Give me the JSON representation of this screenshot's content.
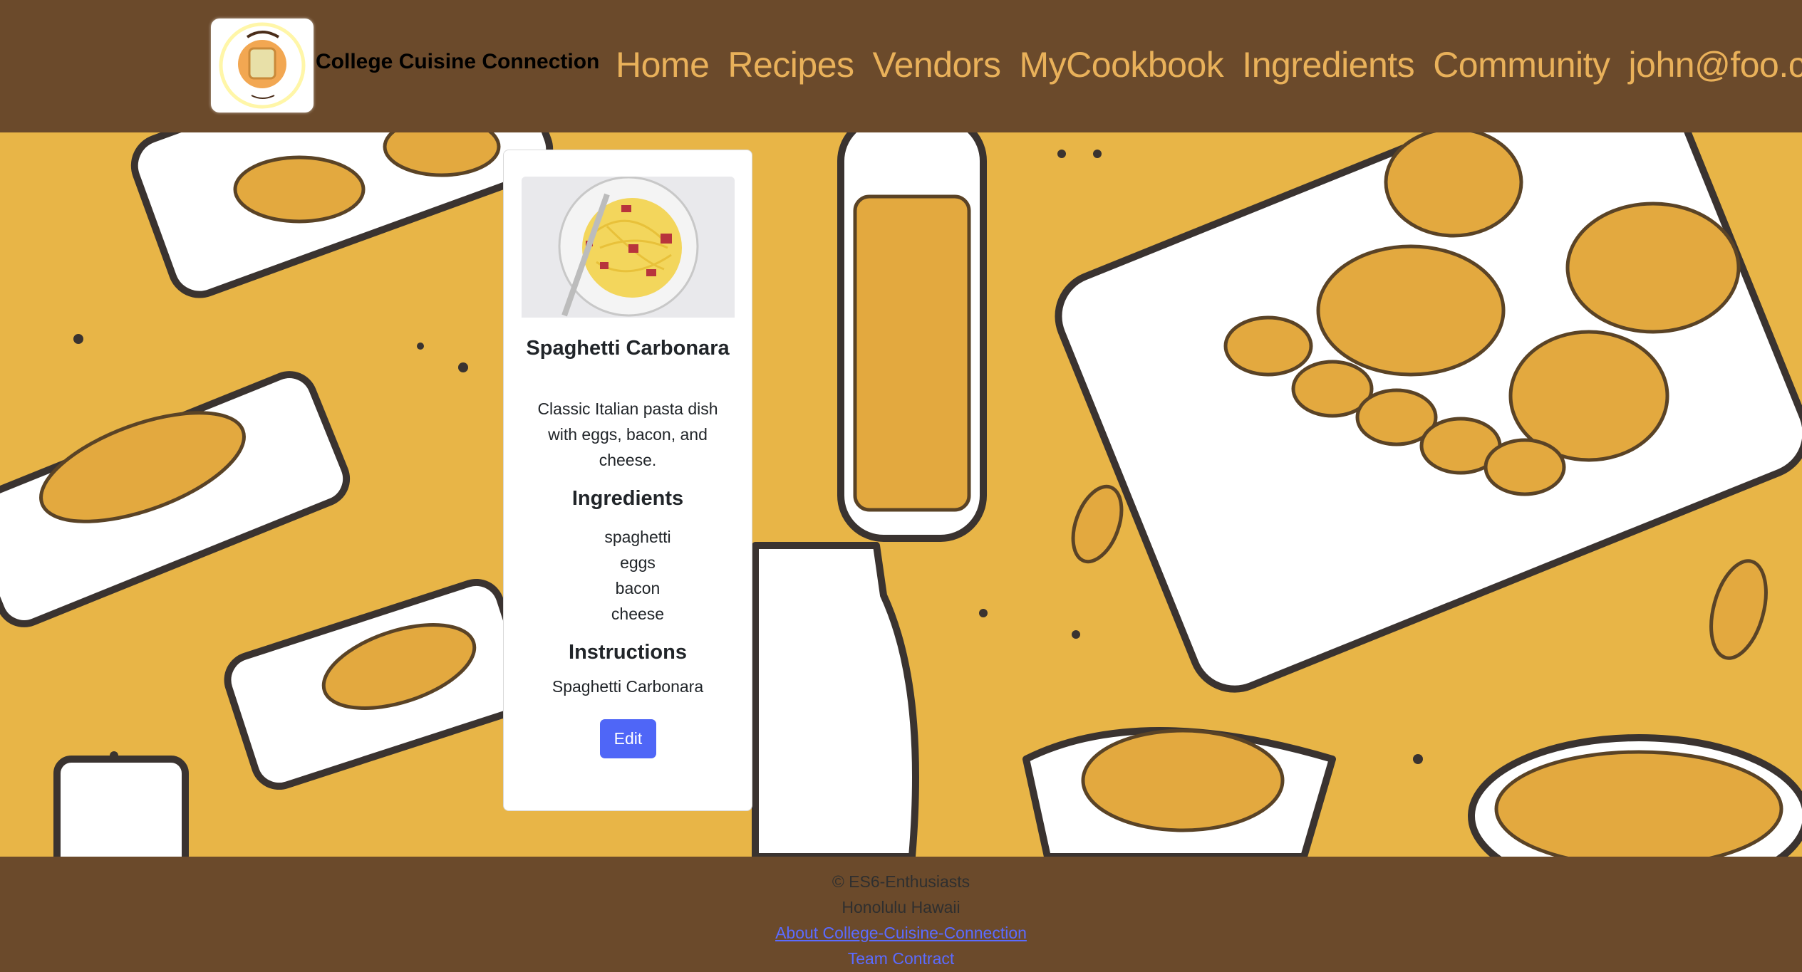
{
  "navbar": {
    "logo_alt": "College Cuisine Connection logo",
    "logo_text_top": "College Cuisine",
    "logo_text_bottom": "Connection",
    "brand": "College Cuisine Connection",
    "links": [
      {
        "label": "Home"
      },
      {
        "label": "Recipes"
      },
      {
        "label": "Vendors"
      },
      {
        "label": "MyCookbook"
      },
      {
        "label": "Ingredients"
      },
      {
        "label": "Community"
      },
      {
        "label": "john@foo.com"
      }
    ],
    "colors": {
      "background": "#6B4A2B",
      "link": "#E9B15A"
    }
  },
  "recipe_card": {
    "image_alt": "Spaghetti Carbonara",
    "title": "Spaghetti Carbonara",
    "description": "Classic Italian pasta dish with eggs, bacon, and cheese.",
    "ingredients_heading": "Ingredients",
    "ingredients": [
      "spaghetti",
      "eggs",
      "bacon",
      "cheese"
    ],
    "instructions_heading": "Instructions",
    "instructions": "Spaghetti Carbonara",
    "edit_label": "Edit",
    "colors": {
      "button": "#4F66F7"
    }
  },
  "footer": {
    "copyright": "© ES6-Enthusiasts",
    "location": "Honolulu Hawaii",
    "about_link": "About College-Cuisine-Connection",
    "team_link": "Team Contract"
  },
  "hero": {
    "background_color": "#E8B547"
  }
}
